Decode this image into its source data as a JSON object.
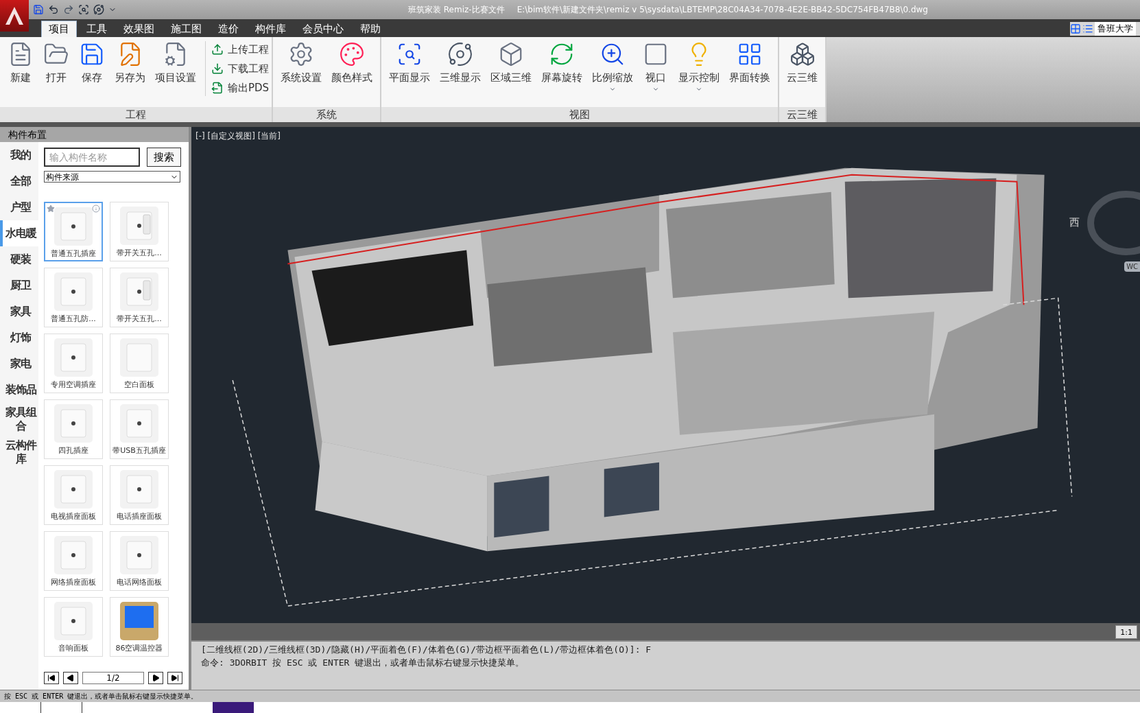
{
  "title_bar": {
    "app_title": "班筑家装 Remiz-比赛文件",
    "file_path": "E:\\bim软件\\新建文件夹\\remiz v 5\\sysdata\\LBTEMP\\28C04A34-7078-4E2E-BB42-5DC754FB47B8\\0.dwg"
  },
  "tabs": [
    {
      "label": "项目",
      "selected": true
    },
    {
      "label": "工具",
      "selected": false
    },
    {
      "label": "效果图",
      "selected": false
    },
    {
      "label": "施工图",
      "selected": false
    },
    {
      "label": "造价",
      "selected": false
    },
    {
      "label": "构件库",
      "selected": false
    },
    {
      "label": "会员中心",
      "selected": false
    },
    {
      "label": "帮助",
      "selected": false
    }
  ],
  "university_link": "鲁班大学",
  "ribbon_groups": [
    {
      "title": "工程",
      "buttons": [
        {
          "label": "新建",
          "has_menu": false
        },
        {
          "label": "打开",
          "has_menu": false
        },
        {
          "label": "保存",
          "has_menu": false
        },
        {
          "label": "另存为",
          "has_menu": false
        },
        {
          "label": "项目设置",
          "has_menu": false
        }
      ],
      "small_buttons": [
        "上传工程",
        "下载工程",
        "输出PDS"
      ]
    },
    {
      "title": "系统",
      "buttons": [
        {
          "label": "系统设置",
          "has_menu": false
        },
        {
          "label": "颜色样式",
          "has_menu": false
        }
      ]
    },
    {
      "title": "视图",
      "buttons": [
        {
          "label": "平面显示",
          "has_menu": false
        },
        {
          "label": "三维显示",
          "has_menu": false
        },
        {
          "label": "区域三维",
          "has_menu": false
        },
        {
          "label": "屏幕旋转",
          "has_menu": false
        },
        {
          "label": "比例缩放",
          "has_menu": true
        },
        {
          "label": "视口",
          "has_menu": true
        },
        {
          "label": "显示控制",
          "has_menu": true
        },
        {
          "label": "界面转换",
          "has_menu": false
        }
      ]
    },
    {
      "title": "云三维",
      "buttons": [
        {
          "label": "云三维",
          "has_menu": false
        }
      ]
    }
  ],
  "component_panel": {
    "title": "构件布置",
    "categories": [
      {
        "label": "我的",
        "selected": false
      },
      {
        "label": "全部",
        "selected": false
      },
      {
        "label": "户型",
        "selected": false
      },
      {
        "label": "水电暖",
        "selected": true
      },
      {
        "label": "硬装",
        "selected": false
      },
      {
        "label": "厨卫",
        "selected": false
      },
      {
        "label": "家具",
        "selected": false
      },
      {
        "label": "灯饰",
        "selected": false
      },
      {
        "label": "家电",
        "selected": false
      },
      {
        "label": "装饰品",
        "selected": false
      },
      {
        "label": "家具组合",
        "selected": false
      },
      {
        "label": "云构件库",
        "selected": false
      }
    ],
    "search": {
      "placeholder": "输入构件名称",
      "button": "搜索"
    },
    "source_select": "构件来源",
    "items": [
      {
        "label": "普通五孔插座",
        "selected": true
      },
      {
        "label": "带开关五孔...",
        "selected": false
      },
      {
        "label": "普通五孔防...",
        "selected": false
      },
      {
        "label": "带开关五孔...",
        "selected": false
      },
      {
        "label": "专用空调插座",
        "selected": false
      },
      {
        "label": "空白面板",
        "selected": false
      },
      {
        "label": "四孔插座",
        "selected": false
      },
      {
        "label": "带USB五孔插座",
        "selected": false
      },
      {
        "label": "电视插座面板",
        "selected": false
      },
      {
        "label": "电话插座面板",
        "selected": false
      },
      {
        "label": "网络插座面板",
        "selected": false
      },
      {
        "label": "电话网络面板",
        "selected": false
      },
      {
        "label": "音响面板",
        "selected": false
      },
      {
        "label": "86空调温控器",
        "selected": false
      }
    ],
    "page": "1/2"
  },
  "viewport": {
    "view_label": "[-] [自定义视图] [当前]",
    "compass_west": "西",
    "wcs_label": "WC",
    "scale": "1:1"
  },
  "command_lines": [
    "[二维线框(2D)/三维线框(3D)/隐藏(H)/平面着色(F)/体着色(G)/带边框平面着色(L)/带边框体着色(O)]: F",
    "命令: 3DORBIT 按 ESC 或 ENTER 键退出，或者单击鼠标右键显示快捷菜单。"
  ],
  "status_text": "按 ESC 或 ENTER 键退出，或者单击鼠标右键显示快捷菜单。"
}
